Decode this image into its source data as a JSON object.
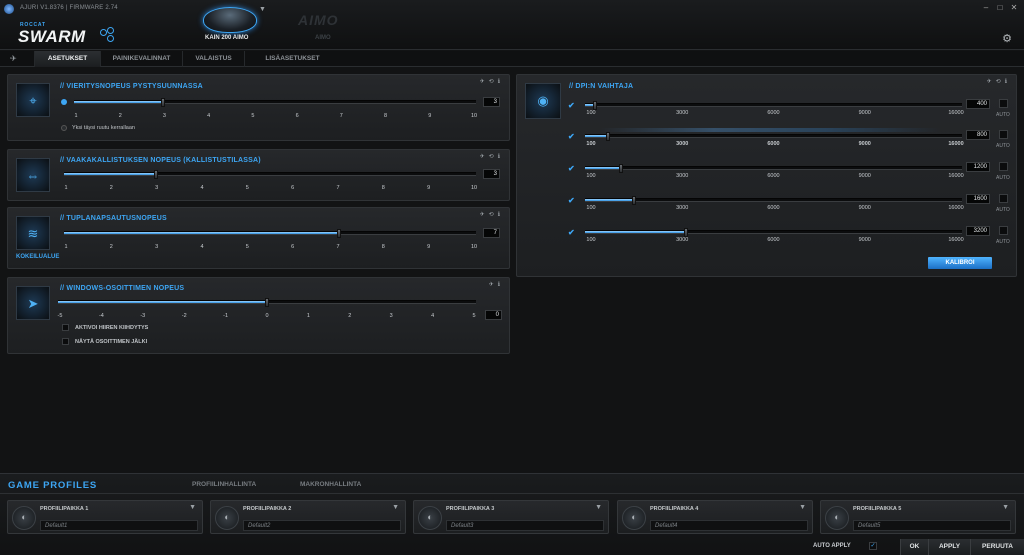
{
  "window": {
    "version": "AJURI V1.8376 | FIRMWARE 2.74",
    "brand_small": "ROCCAT",
    "brand": "SWARM",
    "device_active": "KAIN 200 AIMO",
    "device_other_logo": "AIMO",
    "device_other": "AIMO"
  },
  "tabs": [
    {
      "label": "ASETUKSET"
    },
    {
      "label": "PAINIKEVALINNAT"
    },
    {
      "label": "VALAISTUS"
    },
    {
      "label": "LISÄASETUKSET"
    }
  ],
  "panels": {
    "vertical_scroll": {
      "title": "// VIERITYSNOPEUS PYSTYSUUNNASSA",
      "value": "3",
      "level": 3,
      "ticks": [
        "1",
        "2",
        "3",
        "4",
        "5",
        "6",
        "7",
        "8",
        "9",
        "10"
      ],
      "option": "Yksi täysi ruutu kerrallaan"
    },
    "horizontal_tilt": {
      "title": "// VAAKAKALLISTUKSEN NOPEUS (KALLISTUSTILASSA)",
      "value": "3",
      "level": 3,
      "ticks": [
        "1",
        "2",
        "3",
        "4",
        "5",
        "6",
        "7",
        "8",
        "9",
        "10"
      ]
    },
    "double_click": {
      "title": "// TUPLANAPSAUTUSNOPEUS",
      "value": "7",
      "level": 7,
      "ticks": [
        "1",
        "2",
        "3",
        "4",
        "5",
        "6",
        "7",
        "8",
        "9",
        "10"
      ],
      "try_label": "KOKEILUALUE"
    },
    "pointer_speed": {
      "title": "// WINDOWS-OSOITTIMEN NOPEUS",
      "value": "0",
      "level": 0,
      "ticks": [
        "-5",
        "-4",
        "-3",
        "-2",
        "-1",
        "0",
        "1",
        "2",
        "3",
        "4",
        "5"
      ],
      "option1": "AKTIVOI HIIREN KIIHDYTYS",
      "option2": "NÄYTÄ OSOITTIMEN JÄLKI"
    },
    "dpi": {
      "title": "// DPI:N VAIHTAJA",
      "ticks": [
        "100",
        "3000",
        "6000",
        "9000",
        "16000"
      ],
      "auto_label": "AUTO",
      "levels": [
        {
          "value": "400",
          "dpi": 400
        },
        {
          "value": "800",
          "dpi": 800
        },
        {
          "value": "1200",
          "dpi": 1200
        },
        {
          "value": "1600",
          "dpi": 1600
        },
        {
          "value": "3200",
          "dpi": 3200
        }
      ],
      "calibrate": "KALIBROI"
    }
  },
  "bottom": {
    "title": "GAME PROFILES",
    "tab1": "PROFIILINHALLINTA",
    "tab2": "MAKRONHALLINTA",
    "slots": [
      {
        "title": "PROFIILIPAIKKA 1",
        "name": "Default1"
      },
      {
        "title": "PROFIILIPAIKKA 2",
        "name": "Default2"
      },
      {
        "title": "PROFIILIPAIKKA 3",
        "name": "Default3"
      },
      {
        "title": "PROFIILIPAIKKA 4",
        "name": "Default4"
      },
      {
        "title": "PROFIILIPAIKKA 5",
        "name": "Default5"
      }
    ],
    "auto_apply": "AUTO APPLY",
    "ok": "OK",
    "apply": "APPLY",
    "cancel": "PERUUTA"
  }
}
